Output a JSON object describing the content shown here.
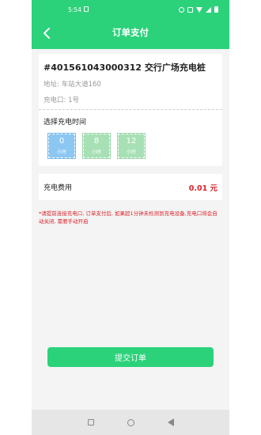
{
  "status_bar": {
    "time": "5:54",
    "icons": [
      "sim-icon",
      "alarm-icon",
      "nfc-icon",
      "wifi-icon",
      "signal-icon",
      "battery-icon"
    ]
  },
  "header": {
    "title": "订单支付",
    "back_icon": "chevron-left-icon",
    "bg_color": "#2bd27a"
  },
  "station": {
    "title": "#401561043000312 交行广场充电桩",
    "address": "地址: 车站大道160",
    "port": "充电口: 1号"
  },
  "duration": {
    "label": "选择充电时间",
    "options": [
      {
        "value": "0",
        "unit": "小时",
        "selected": true
      },
      {
        "value": "8",
        "unit": "小时",
        "selected": false
      },
      {
        "value": "12",
        "unit": "小时",
        "selected": false
      }
    ]
  },
  "fee": {
    "label": "充电费用",
    "value": "0.01 元",
    "value_color": "#d9242b"
  },
  "notice": "*请提前连接充电口, 订单支付后, 如果超1分钟未检测到充电设备,充电口将会自动关闭, 需要手动开启",
  "submit_label": "提交订单",
  "nav": {
    "buttons": [
      "recent-apps-icon",
      "home-icon",
      "back-icon"
    ]
  }
}
